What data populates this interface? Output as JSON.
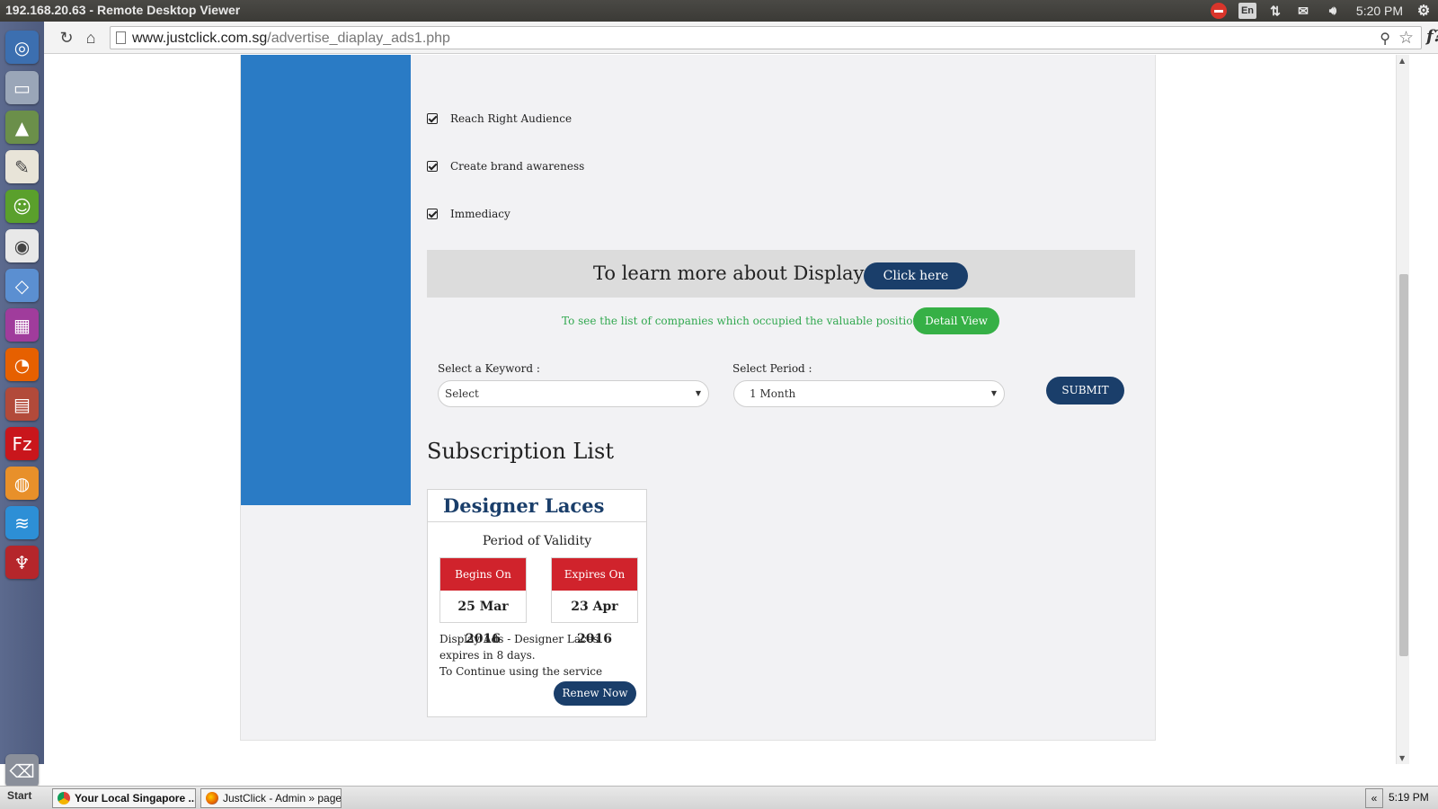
{
  "system": {
    "window_title": "192.168.20.63 - Remote Desktop Viewer",
    "language": "En",
    "clock": "5:20 PM"
  },
  "browser": {
    "url_host": "www.justclick.com.sg",
    "url_path": "/advertise_diaplay_ads1.php"
  },
  "launcher": {
    "icons": [
      "dash-icon",
      "drive-icon",
      "photo-icon",
      "text-editor-icon",
      "monkey-icon",
      "chrome-icon",
      "virtualbox-icon",
      "workspace-icon",
      "firefox-icon",
      "files-icon",
      "filezilla-icon",
      "blender-icon",
      "thunderbird-icon",
      "wine-icon",
      "trash-icon"
    ]
  },
  "features": [
    {
      "label": "Reach Right Audience"
    },
    {
      "label": "Create brand awareness"
    },
    {
      "label": "Immediacy"
    }
  ],
  "learn": {
    "text": "To learn more about Display Ads,",
    "button": "Click here"
  },
  "companies": {
    "text": "To see the list of companies which occupied the valuable position,Go to",
    "button": "Detail View"
  },
  "form": {
    "keyword_label": "Select a Keyword :",
    "keyword_value": "Select",
    "period_label": "Select Period :",
    "period_value": "1 Month",
    "submit": "SUBMIT"
  },
  "subscription": {
    "heading": "Subscription List",
    "card": {
      "title": "Designer Laces",
      "validity_label": "Period of Validity",
      "begins_label": "Begins On",
      "begins_value": "25 Mar 2016",
      "expires_label": "Expires On",
      "expires_value": "23 Apr 2016",
      "note_line1": "Display Ads - Designer Laces expires in 8 days.",
      "note_line2": "To Continue using the service",
      "renew": "Renew Now"
    }
  },
  "taskbar": {
    "start": "Start",
    "task1": "Your Local Singapore ...",
    "task2": "JustClick - Admin » page...",
    "collapse": "«",
    "clock": "5:19 PM"
  },
  "colors": {
    "sidebar_blue": "#2a7bc5",
    "navy_button": "#1a3e6a",
    "green_button": "#36b046",
    "red_header": "#d0232c"
  }
}
